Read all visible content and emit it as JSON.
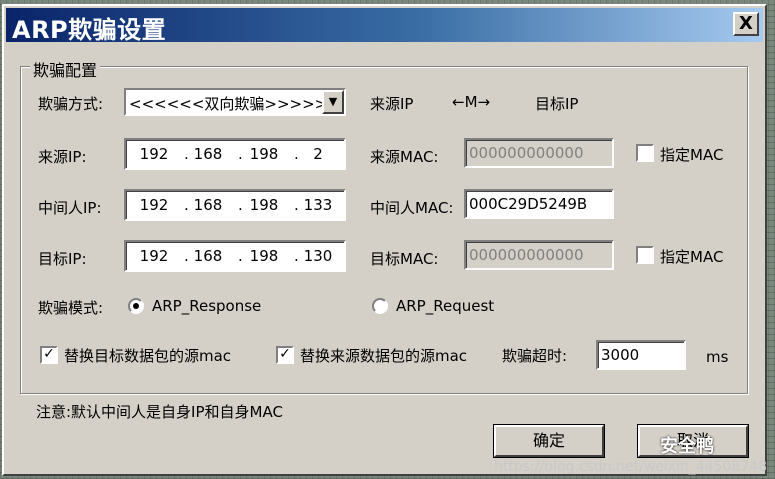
{
  "window": {
    "title": "ARP欺骗设置",
    "close_label": "X"
  },
  "group": {
    "title": "欺骗配置"
  },
  "row_mode": {
    "label": "欺骗方式:",
    "combo_value": "<<<<<<双向欺骗>>>>>>",
    "source_ip_header": "来源IP",
    "arrow_text": "←M→",
    "target_ip_header": "目标IP"
  },
  "source": {
    "ip_label": "来源IP:",
    "ip": [
      "192",
      "168",
      "198",
      "2"
    ],
    "mac_label": "来源MAC:",
    "mac_value": "000000000000",
    "specify_label": "指定MAC"
  },
  "middle": {
    "ip_label": "中间人IP:",
    "ip": [
      "192",
      "168",
      "198",
      "133"
    ],
    "mac_label": "中间人MAC:",
    "mac_value": "000C29D5249B"
  },
  "target": {
    "ip_label": "目标IP:",
    "ip": [
      "192",
      "168",
      "198",
      "130"
    ],
    "mac_label": "目标MAC:",
    "mac_value": "000000000000",
    "specify_label": "指定MAC"
  },
  "spoof_mode": {
    "label": "欺骗模式:",
    "option1": "ARP_Response",
    "option2": "ARP_Request"
  },
  "options": {
    "replace_target": "替换目标数据包的源mac",
    "replace_source": "替换来源数据包的源mac",
    "timeout_label": "欺骗超时:",
    "timeout_value": "3000",
    "timeout_unit": "ms"
  },
  "note": "注意:默认中间人是自身IP和自身MAC",
  "buttons": {
    "ok": "确定",
    "cancel": "取消"
  },
  "watermark": {
    "url": "https://blog.csdn.net/weixin_44508748",
    "brand": "安全鸭"
  }
}
